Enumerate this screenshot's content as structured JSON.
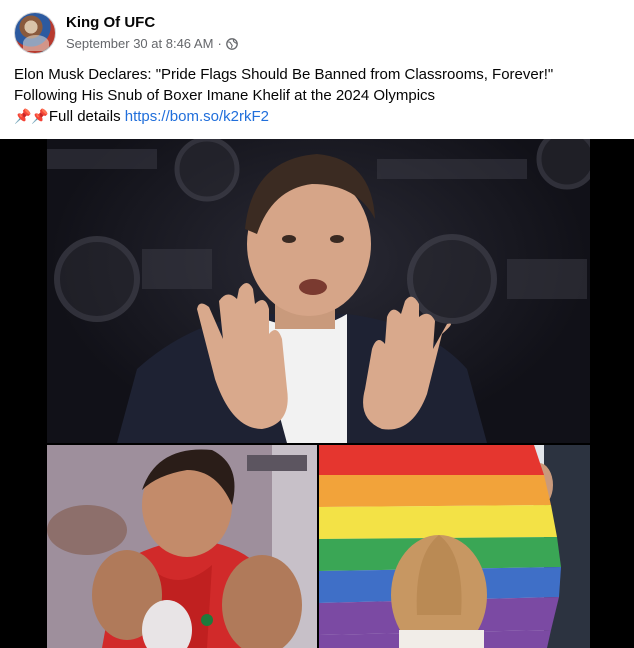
{
  "post": {
    "author": "King Of UFC",
    "timestamp": "September 30 at 8:46 AM",
    "separator": "·",
    "audience_icon": "globe-icon",
    "text_line_1": "Elon Musk Declares: \"Pride Flags Should Be Banned from Classrooms, Forever!\"",
    "text_line_2": "Following His Snub of Boxer Imane Khelif at the 2024 Olympics",
    "pins": "📌📌",
    "details_label": "Full details",
    "link": "https://bom.so/k2rkF2"
  },
  "media": {
    "images": [
      {
        "name": "speaker-photo"
      },
      {
        "name": "boxer-photo"
      },
      {
        "name": "rainbow-flag-photo"
      }
    ]
  },
  "colors": {
    "link": "#216fdb",
    "secondary_text": "#65676b",
    "primary_text": "#050505"
  }
}
